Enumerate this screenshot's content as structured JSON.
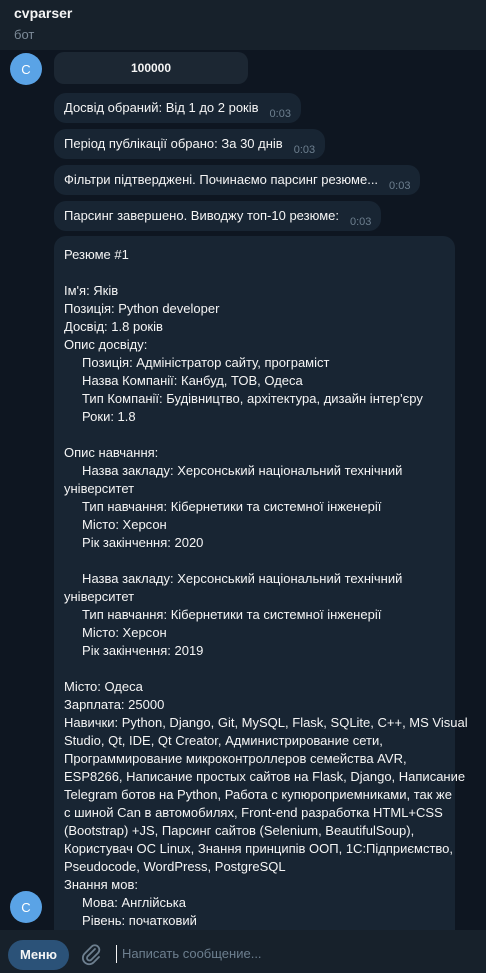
{
  "header": {
    "title": "cvparser",
    "subtitle": "бот"
  },
  "avatar_letter": "С",
  "keyboard_button": "100000",
  "messages": [
    {
      "text": "Досвід обраний: Від 1 до 2 років",
      "time": "0:03"
    },
    {
      "text": "Період публікації обрано: За 30 днів",
      "time": "0:03"
    },
    {
      "text": "Фільтри підтверджені. Починаємо парсинг резюме...",
      "time": "0:03"
    },
    {
      "text": "Парсинг завершено. Виводжу топ-10 резюме:",
      "time": "0:03"
    }
  ],
  "resume_lines": [
    "Резюме #1",
    "",
    "Ім'я: Яків",
    "Позиція: Python developer",
    "Досвід: 1.8 років",
    "Опис досвіду:",
    "     Позиція: Адміністратор сайту, програміст",
    "     Назва Компанії: Канбуд, ТОВ, Одеса",
    "     Тип Компанії: Будівництво, архітектура, дизайн інтер'єру",
    "     Роки: 1.8",
    "",
    "Опис навчання:",
    "     Назва закладу: Херсонський національний технічний",
    "університет",
    "     Тип навчання: Кібернетики та системної інженерії",
    "     Місто: Херсон",
    "     Рік закінчення: 2020",
    "",
    "     Назва закладу: Херсонський національний технічний",
    "університет",
    "     Тип навчання: Кібернетики та системної інженерії",
    "     Місто: Херсон",
    "     Рік закінчення: 2019",
    "",
    "Місто: Одеса",
    "Зарплата: 25000",
    "Навички: Python, Django, Git, MySQL, Flask, SQLite, C++, MS Visual",
    "Studio, Qt, IDE, Qt Creator, Администрирование сети,",
    "Программирование микроконтроллеров семейства AVR,",
    "ESP8266, Написание простых сайтов на Flask, Django, Написание",
    "Telegram ботов на Python, Работа с купюроприемниками, так же",
    "с шиной Can в автомобилях, Front-end разработка HTML+CSS",
    "(Bootstrap) +JS, Парсинг сайтов (Selenium, BeautifulSoup),",
    "Користувач ОС Linux, Знання принципів ООП, 1С:Підприємство,",
    "Pseudocode, WordPress, PostgreSQL",
    "Знання мов:",
    "     Мова: Англійська",
    "     Рівень: початковий"
  ],
  "footer": {
    "menu_label": "Меню",
    "input_placeholder": "Написать сообщение..."
  },
  "colors": {
    "background": "#0e1621",
    "header": "#17212b",
    "bubble": "#182533",
    "avatar": "#5aa3e6",
    "menu_button": "#2b5278"
  }
}
